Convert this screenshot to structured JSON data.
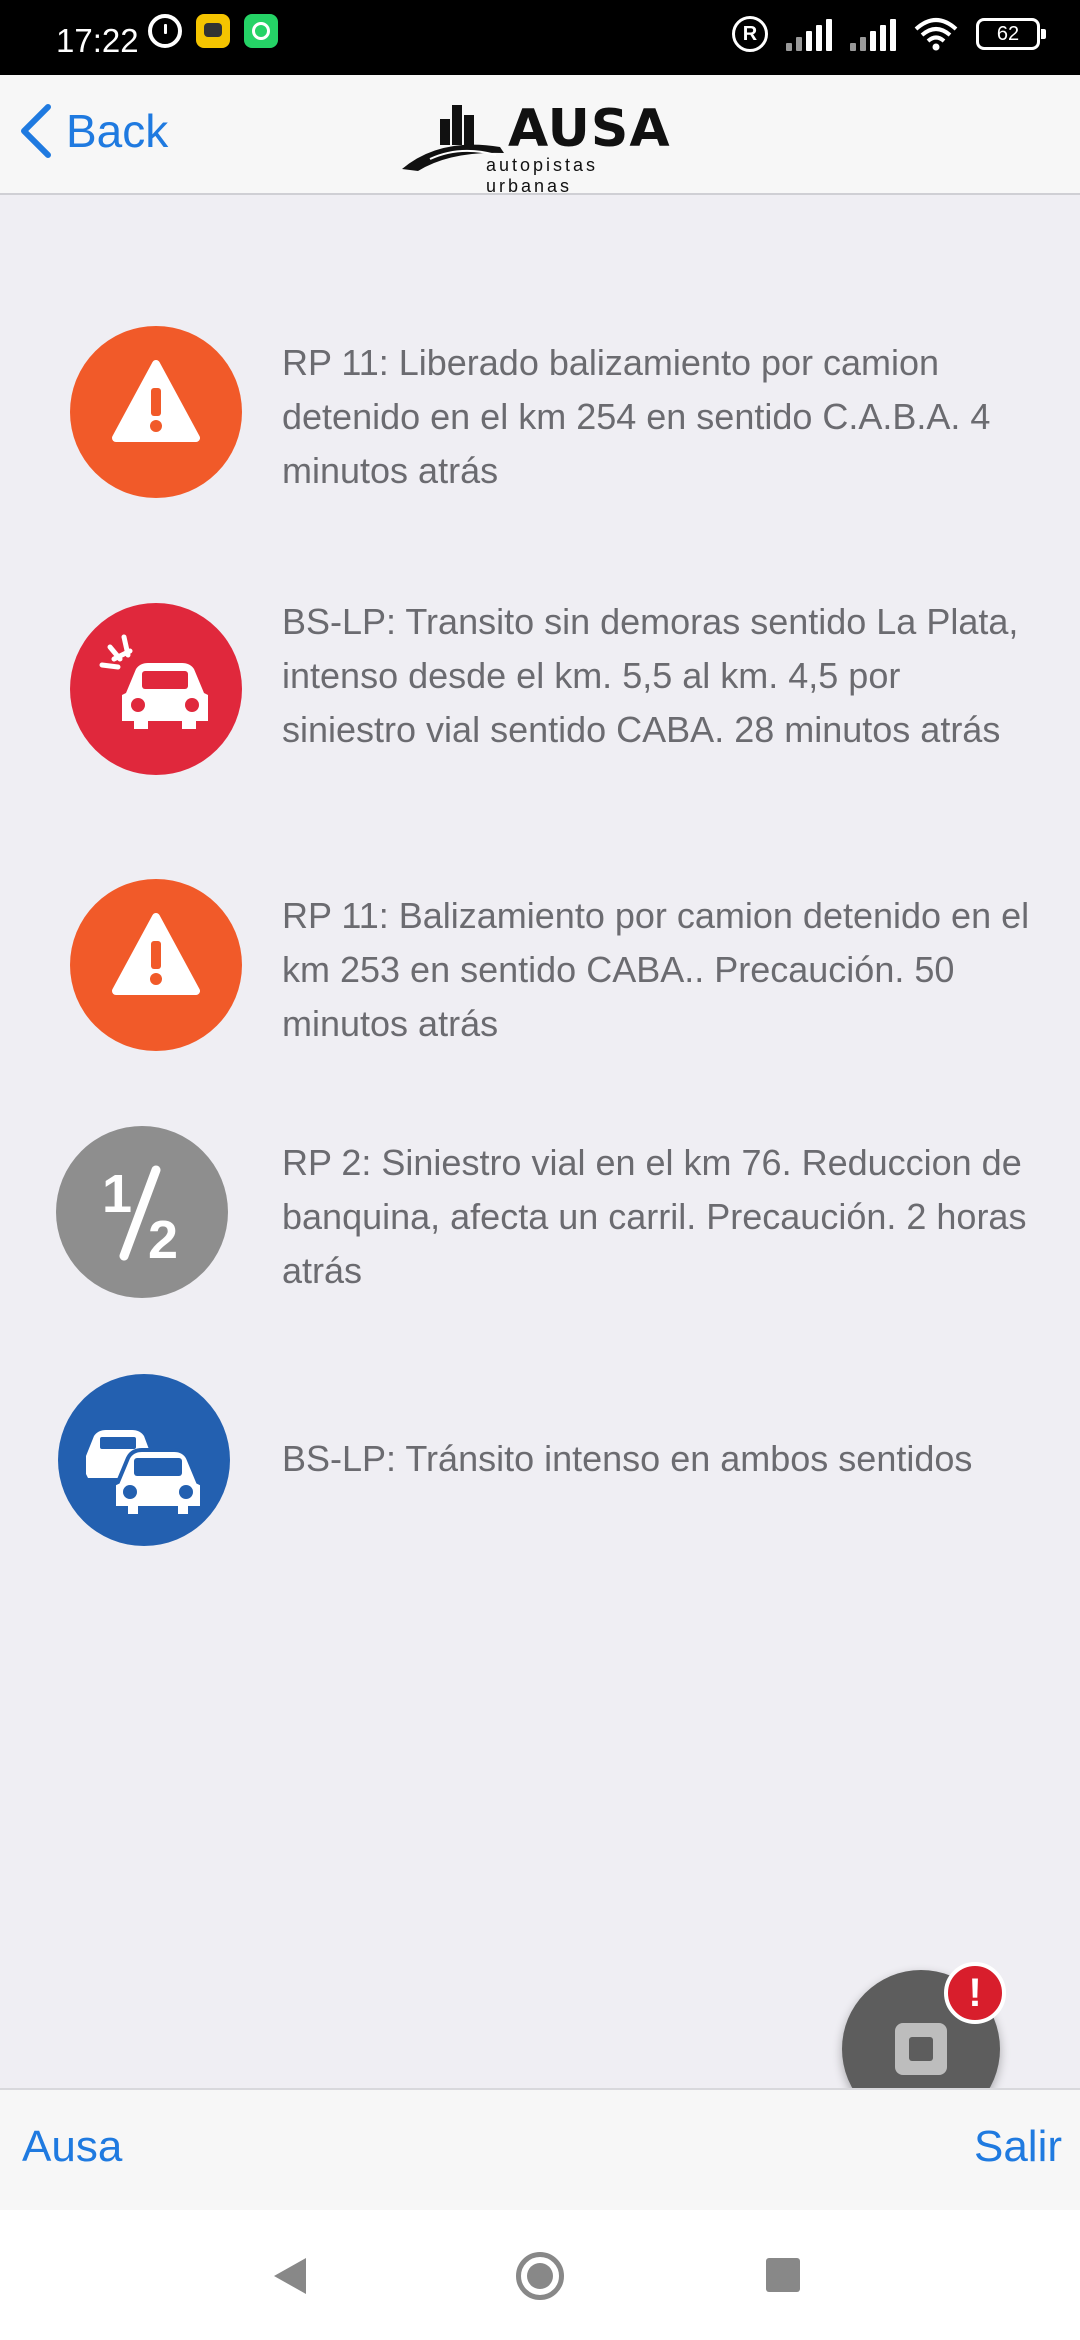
{
  "status_bar": {
    "time": "17:22",
    "battery": "62"
  },
  "nav": {
    "back_label": "Back",
    "logo_title": "AUSA",
    "logo_subtitle": "autopistas urbanas"
  },
  "alerts": [
    {
      "icon": "warning-icon",
      "color": "#f15a29",
      "text": "RP 11: Liberado balizamiento por camion detenido en el km 254 en sentido C.A.B.A. 4 minutos atrás"
    },
    {
      "icon": "car-crash-icon",
      "color": "#e0283c",
      "text": "BS-LP: Transito sin demoras sentido La Plata, intenso desde el km. 5,5 al km. 4,5 por siniestro vial sentido CABA. 28 minutos atrás"
    },
    {
      "icon": "warning-icon",
      "color": "#f15a29",
      "text": "RP 11: Balizamiento por camion detenido en el km 253 en sentido CABA.. Precaución. 50 minutos atrás"
    },
    {
      "icon": "half-lane-icon",
      "color": "#8e8e8e",
      "text": "RP 2: Siniestro vial en el km 76. Reduccion de banquina, afecta un carril. Precaución. 2 horas atrás"
    },
    {
      "icon": "traffic-cars-icon",
      "color": "#2360b0",
      "text": "BS-LP: Tránsito intenso en ambos sentidos"
    }
  ],
  "fab": {
    "badge": "!"
  },
  "toolbar": {
    "left_label": "Ausa",
    "right_label": "Salir"
  }
}
